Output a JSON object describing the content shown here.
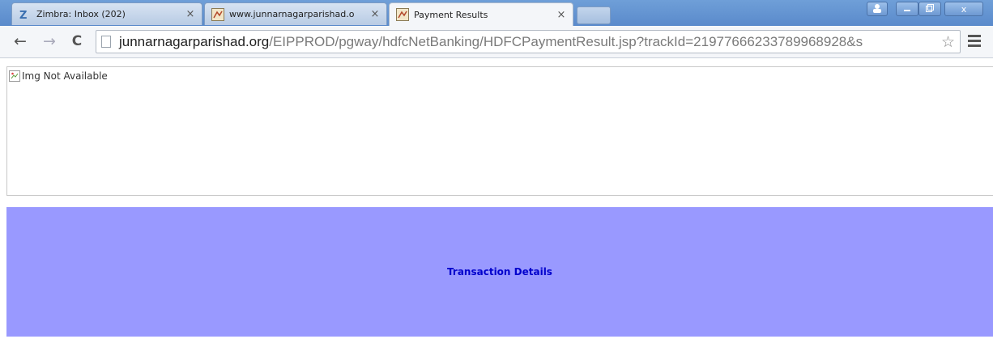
{
  "browser": {
    "tabs": [
      {
        "label": "Zimbra: Inbox (202)",
        "icon": "zimbra-icon",
        "active": false
      },
      {
        "label": "www.junnarnagarparishad.o",
        "icon": "site-favicon-icon",
        "active": false
      },
      {
        "label": "Payment Results",
        "icon": "site-favicon-icon",
        "active": true
      }
    ],
    "tab_close_glyph": "×",
    "window_controls": {
      "user": "👤",
      "minimize": "—",
      "restore": "🗗",
      "close": "x"
    }
  },
  "toolbar": {
    "back": "←",
    "forward": "→",
    "reload": "C",
    "url_domain": "junnarnagarparishad.org",
    "url_path": "/EIPPROD/pgway/hdfcNetBanking/HDFCPaymentResult.jsp?trackId=21977666233789968928&s",
    "star": "☆"
  },
  "page": {
    "broken_image_alt": "Img Not Available",
    "transaction_title": "Transaction Details"
  },
  "colors": {
    "panel_bg": "#9999ff",
    "panel_text": "#0000cc",
    "tabstrip": "#6f9fd8"
  }
}
